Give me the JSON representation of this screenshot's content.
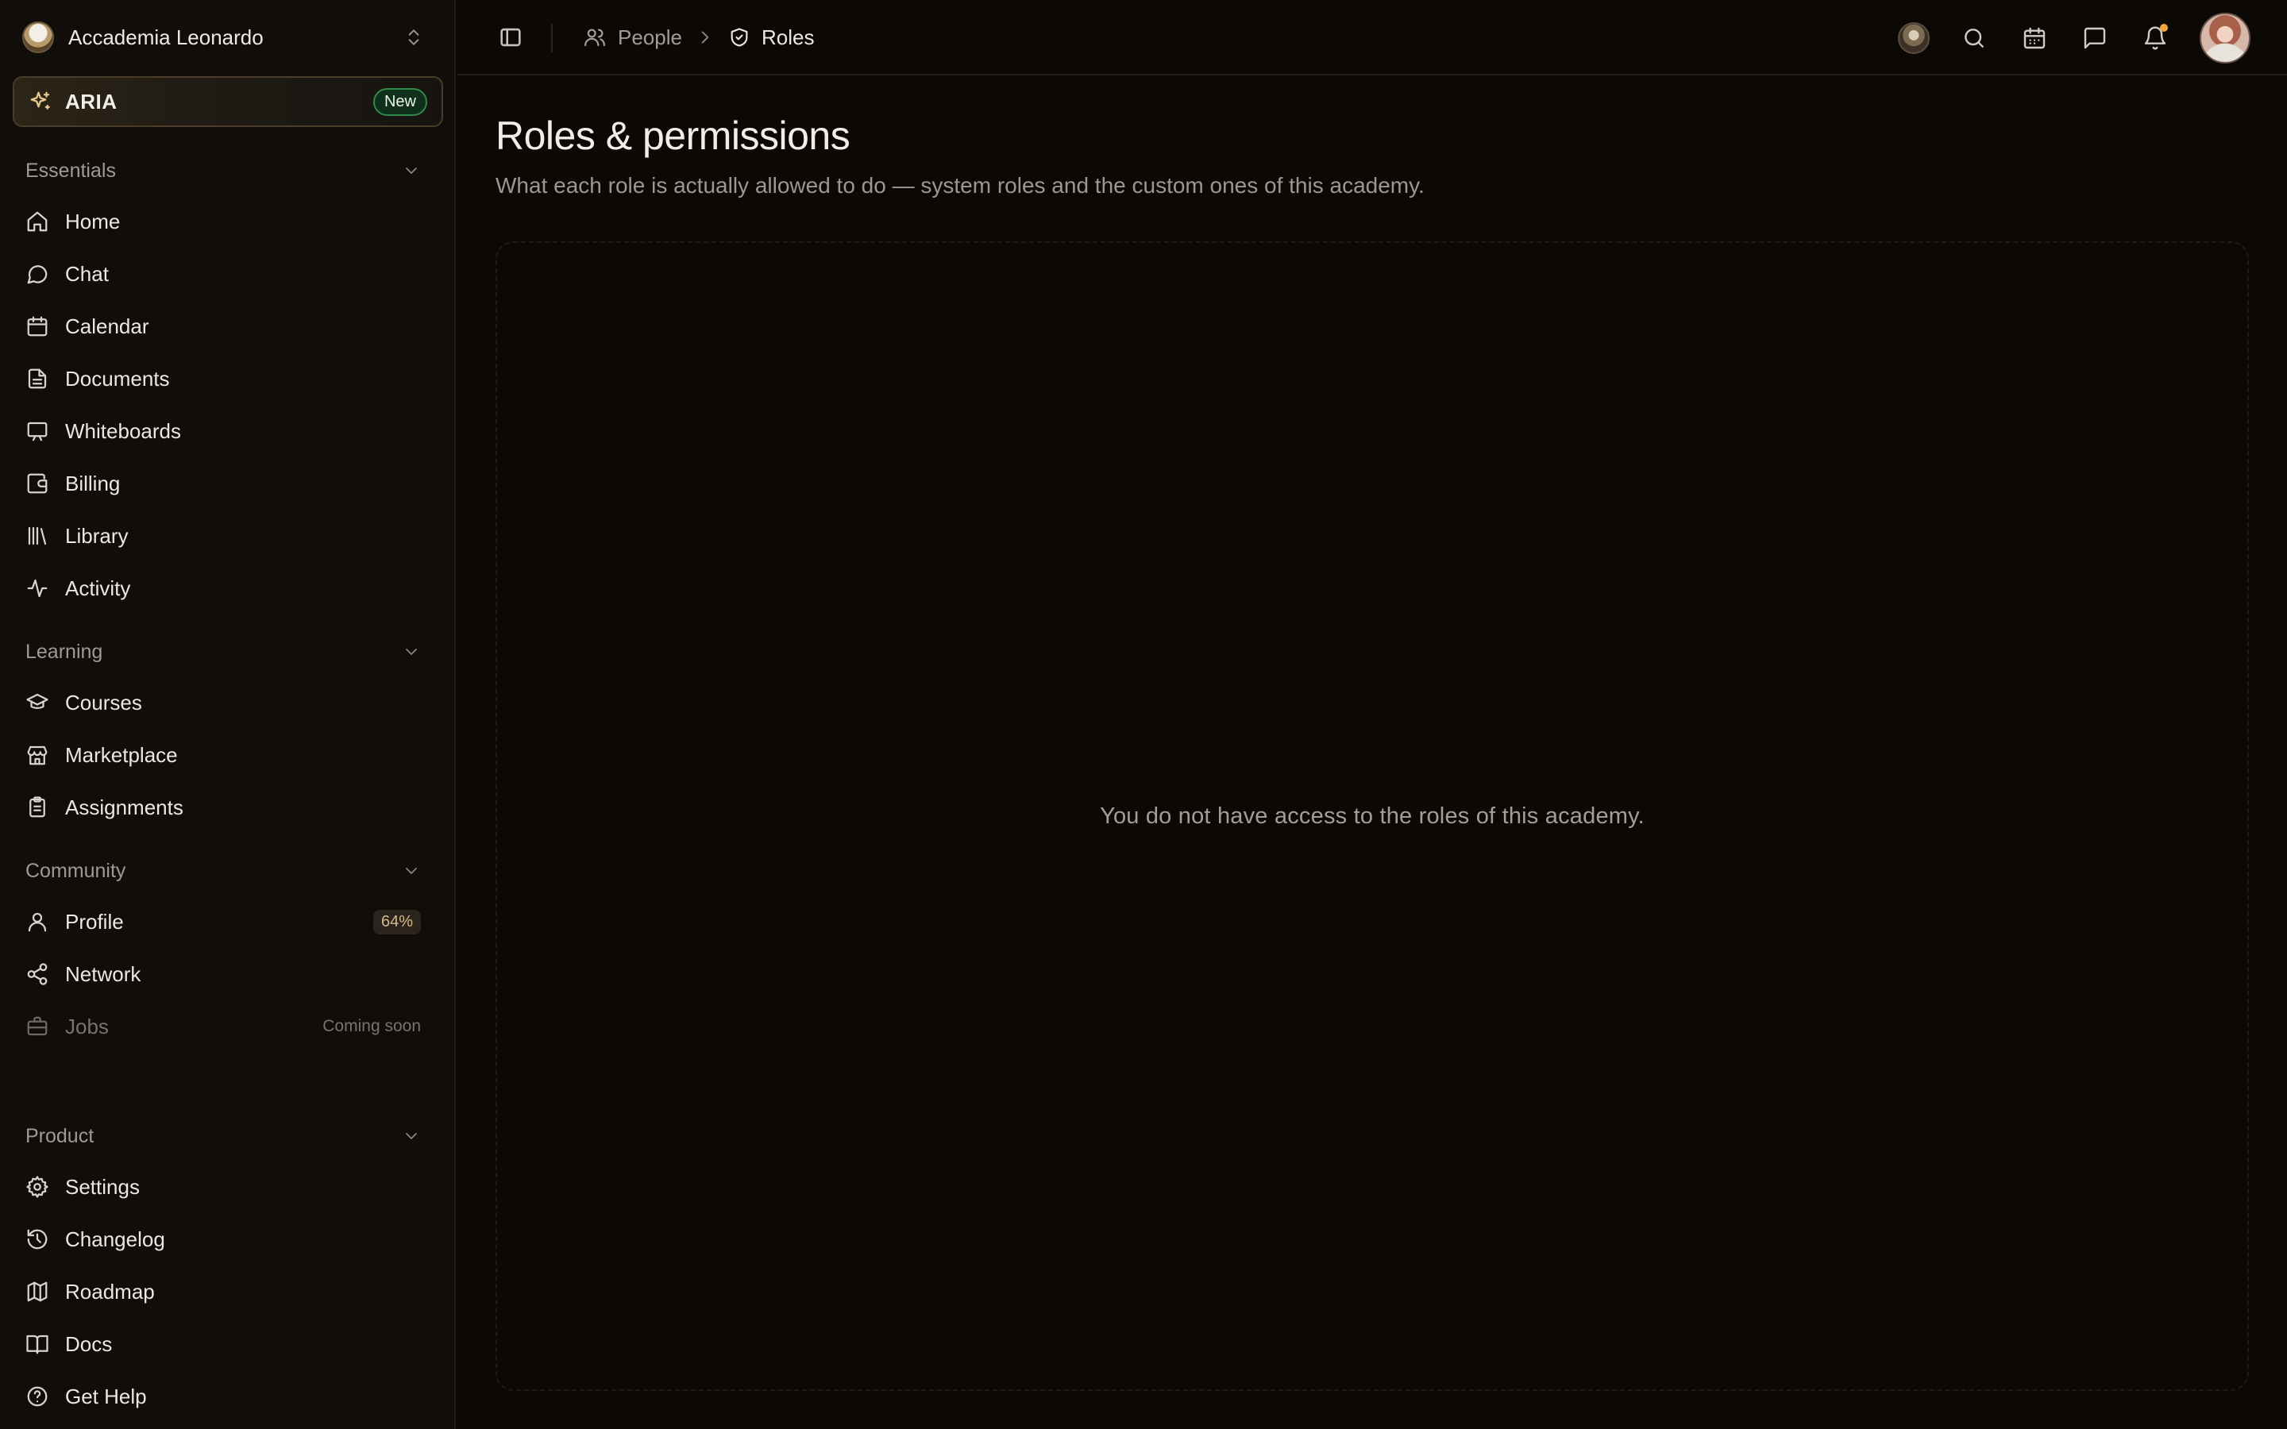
{
  "workspace": {
    "name": "Accademia Leonardo"
  },
  "aria": {
    "label": "ARIA",
    "badge": "New"
  },
  "sections": {
    "essentials": "Essentials",
    "learning": "Learning",
    "community": "Community",
    "product": "Product"
  },
  "nav": {
    "home": "Home",
    "chat": "Chat",
    "calendar": "Calendar",
    "documents": "Documents",
    "whiteboards": "Whiteboards",
    "billing": "Billing",
    "library": "Library",
    "activity": "Activity",
    "courses": "Courses",
    "marketplace": "Marketplace",
    "assignments": "Assignments",
    "profile": "Profile",
    "profile_completion": "64%",
    "network": "Network",
    "jobs": "Jobs",
    "jobs_status": "Coming soon",
    "settings": "Settings",
    "changelog": "Changelog",
    "roadmap": "Roadmap",
    "docs": "Docs",
    "get_help": "Get Help"
  },
  "breadcrumb": {
    "parent": "People",
    "current": "Roles"
  },
  "page": {
    "title": "Roles & permissions",
    "subtitle": "What each role is actually allowed to do — system roles and the custom ones of this academy.",
    "empty_message": "You do not have access to the roles of this academy."
  },
  "colors": {
    "background": "#0b0806",
    "sidebar": "#100d0a",
    "accent_new": "#2f8a4c",
    "notification": "#f0a43c"
  }
}
